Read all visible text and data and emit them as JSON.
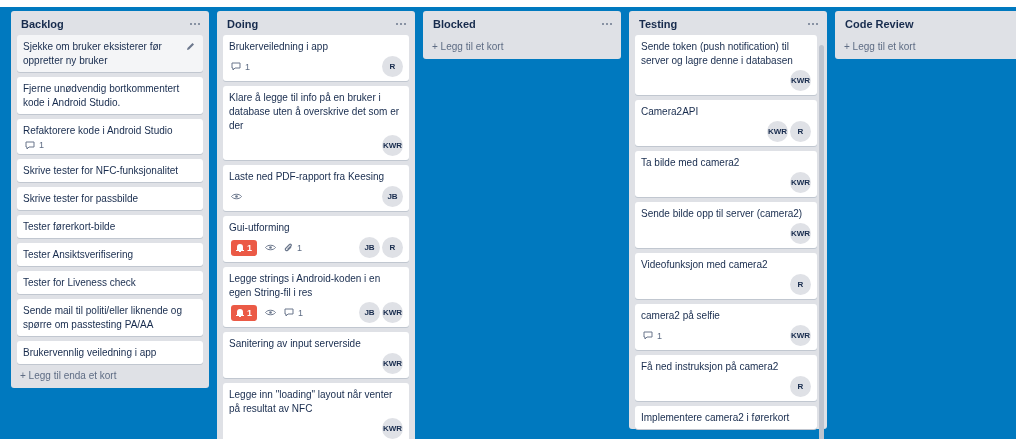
{
  "lists": [
    {
      "title": "Backlog",
      "add_label": "+ Legg til enda et kort",
      "scrollbar": false,
      "cards": [
        {
          "title": "Sjekke om bruker eksisterer før oppretter ny bruker",
          "hovered": true
        },
        {
          "title": "Fjerne unødvendig bortkommentert kode i Android Studio.",
          "hovered": false
        },
        {
          "title": "Refaktorere kode i Android Studio",
          "hovered": false,
          "badges": [
            {
              "kind": "comment",
              "text": "1"
            }
          ]
        },
        {
          "title": "Skrive tester for NFC-funksjonalitet",
          "hovered": false
        },
        {
          "title": "Skrive tester for passbilde",
          "hovered": false
        },
        {
          "title": "Tester førerkort-bilde",
          "hovered": false
        },
        {
          "title": "Tester Ansiktsverifisering",
          "hovered": false
        },
        {
          "title": "Tester for Liveness check",
          "hovered": false
        },
        {
          "title": "Sende mail til politi/eller liknende og spørre om passtesting PA/AA",
          "hovered": false
        },
        {
          "title": "Brukervennlig veiledning i app",
          "hovered": false
        }
      ]
    },
    {
      "title": "Doing",
      "scrollbar": false,
      "cards": [
        {
          "title": "Brukerveiledning i app",
          "hovered": false,
          "badges": [
            {
              "kind": "comment",
              "text": "1"
            }
          ],
          "members": [
            "R"
          ]
        },
        {
          "title": "Klare å legge til info på en bruker i database uten å overskrive det som er der",
          "hovered": false,
          "members": [
            "KWR"
          ]
        },
        {
          "title": "Laste ned PDF-rapport fra Keesing",
          "hovered": false,
          "badges": [
            {
              "kind": "watch"
            }
          ],
          "members": [
            "JB"
          ]
        },
        {
          "title": "Gui-utforming",
          "hovered": false,
          "badges": [
            {
              "kind": "alert",
              "text": "1"
            },
            {
              "kind": "watch"
            },
            {
              "kind": "attachment",
              "text": "1"
            }
          ],
          "members": [
            "JB",
            "R"
          ]
        },
        {
          "title": "Legge strings i Android-koden i en egen String-fil i res",
          "hovered": false,
          "badges": [
            {
              "kind": "alert",
              "text": "1"
            },
            {
              "kind": "watch"
            },
            {
              "kind": "comment",
              "text": "1"
            }
          ],
          "members": [
            "JB",
            "KWR"
          ]
        },
        {
          "title": "Sanitering av input serverside",
          "hovered": false,
          "members": [
            "KWR"
          ]
        },
        {
          "title": "Legge inn \"loading\" layout når venter på resultat av NFC",
          "hovered": false,
          "members": [
            "KWR"
          ]
        }
      ]
    },
    {
      "title": "Blocked",
      "add_label": "+ Legg til et kort",
      "scrollbar": false
    },
    {
      "title": "Testing",
      "scrollbar": true,
      "cards": [
        {
          "title": "Sende token (push notification) til server og lagre denne i databasen",
          "hovered": false,
          "members": [
            "KWR"
          ]
        },
        {
          "title": "Camera2API",
          "hovered": false,
          "members": [
            "KWR",
            "R"
          ]
        },
        {
          "title": "Ta bilde med camera2",
          "hovered": false,
          "members": [
            "KWR"
          ]
        },
        {
          "title": "Sende bilde opp til server (camera2)",
          "hovered": false,
          "members": [
            "KWR"
          ]
        },
        {
          "title": "Videofunksjon med camera2",
          "hovered": false,
          "members": [
            "R"
          ]
        },
        {
          "title": "camera2 på selfie",
          "hovered": false,
          "badges": [
            {
              "kind": "comment",
              "text": "1"
            }
          ],
          "members": [
            "KWR"
          ]
        },
        {
          "title": "Få ned instruksjon på camera2",
          "hovered": false,
          "members": [
            "R"
          ]
        },
        {
          "title": "Implementere camera2 i førerkort",
          "hovered": false
        }
      ]
    },
    {
      "title": "Code Review",
      "add_label": "+ Legg til et kort"
    }
  ]
}
